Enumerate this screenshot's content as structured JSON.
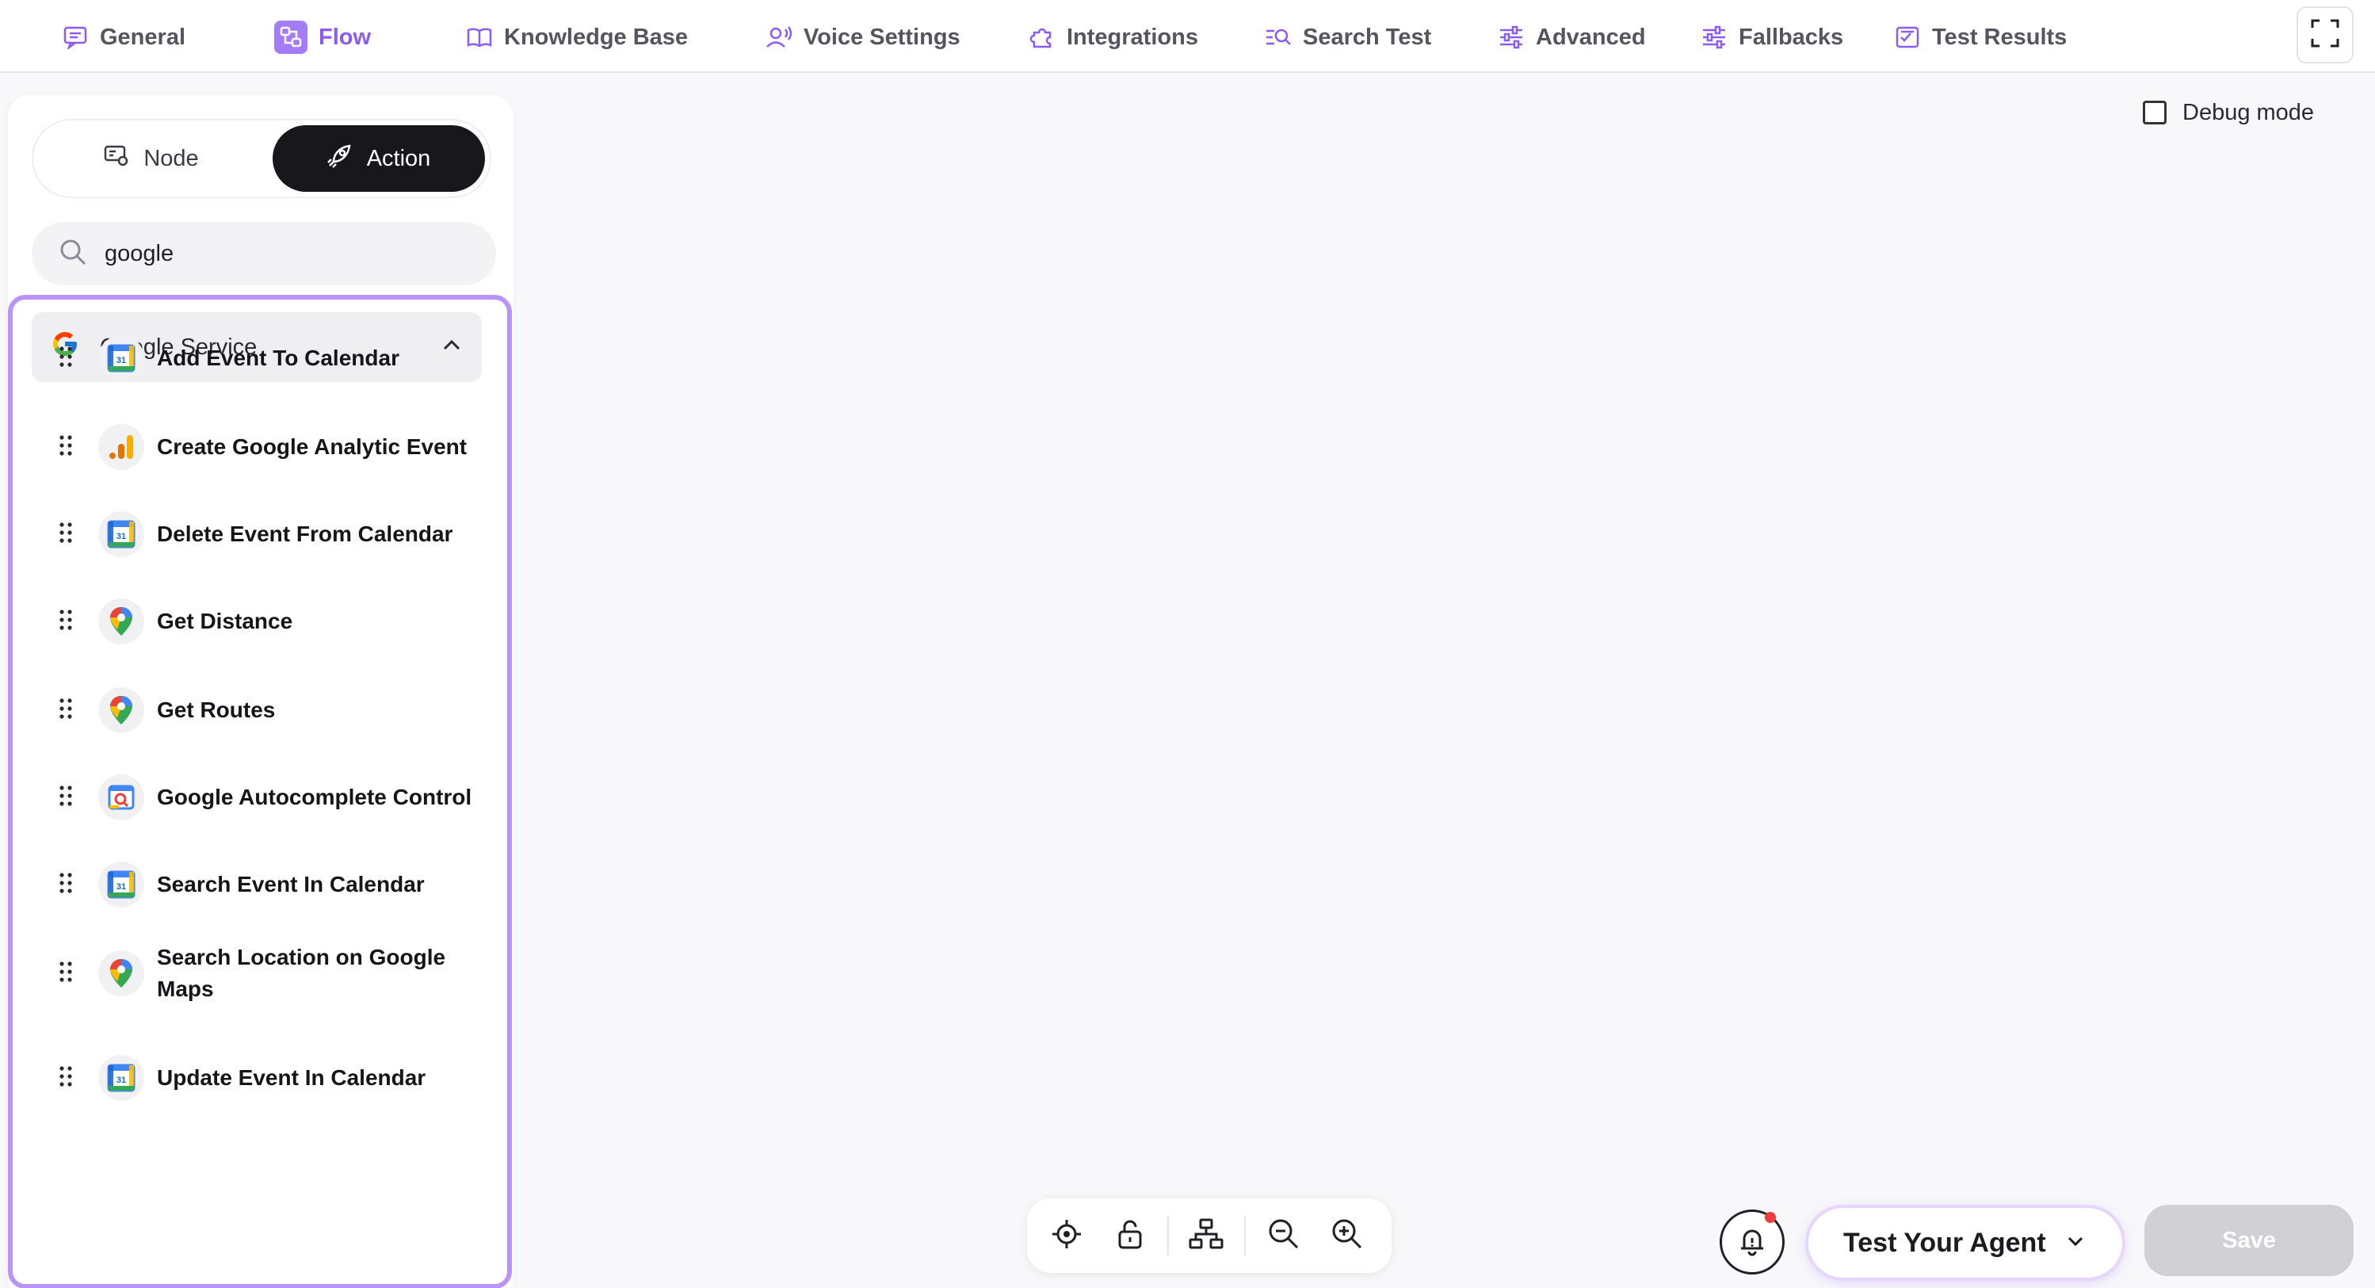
{
  "nav": {
    "items": [
      {
        "label": "General",
        "icon": "message-square-icon"
      },
      {
        "label": "Flow",
        "icon": "flow-icon",
        "active": true
      },
      {
        "label": "Knowledge Base",
        "icon": "book-icon"
      },
      {
        "label": "Voice Settings",
        "icon": "voice-user-icon"
      },
      {
        "label": "Integrations",
        "icon": "puzzle-icon"
      },
      {
        "label": "Search Test",
        "icon": "search-list-icon"
      },
      {
        "label": "Advanced",
        "icon": "sliders-icon"
      },
      {
        "label": "Fallbacks",
        "icon": "sliders-icon"
      },
      {
        "label": "Test Results",
        "icon": "checklist-icon"
      }
    ],
    "accent": "#8a5cf5"
  },
  "debug": {
    "label": "Debug mode",
    "checked": false
  },
  "panel": {
    "toggle": {
      "node_label": "Node",
      "action_label": "Action",
      "selected": "Action"
    },
    "search": {
      "value": "google"
    },
    "group": {
      "label": "Google Service",
      "expanded": true
    },
    "items": [
      {
        "label": "Add Event To Calendar",
        "icon": "google-calendar-icon"
      },
      {
        "label": "Create Google Analytic Event",
        "icon": "google-analytics-icon"
      },
      {
        "label": "Delete Event From Calendar",
        "icon": "google-calendar-icon"
      },
      {
        "label": "Get Distance",
        "icon": "google-maps-icon"
      },
      {
        "label": "Get Routes",
        "icon": "google-maps-icon"
      },
      {
        "label": "Google Autocomplete Control",
        "icon": "google-autocomplete-icon"
      },
      {
        "label": "Search Event In Calendar",
        "icon": "google-calendar-icon"
      },
      {
        "label": "Search Location on Google Maps",
        "icon": "google-maps-icon"
      },
      {
        "label": "Update Event In Calendar",
        "icon": "google-calendar-icon"
      }
    ],
    "highlight_color": "#b794f6"
  },
  "bottom": {
    "test_label": "Test Your Agent",
    "save_label": "Save"
  }
}
